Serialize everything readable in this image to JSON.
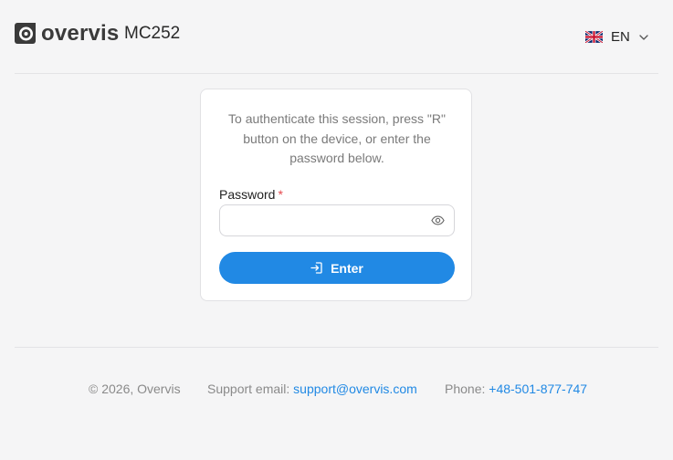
{
  "header": {
    "brand": "overvis",
    "model": "MC252",
    "language": {
      "code": "EN",
      "flag": "uk-flag-icon"
    }
  },
  "login": {
    "message": "To authenticate this session, press \"R\" button on the device, or enter the password below.",
    "password_label": "Password",
    "required_mark": "*",
    "password_value": "",
    "password_placeholder": "",
    "enter_label": "Enter"
  },
  "footer": {
    "copyright": "© 2026, Overvis",
    "support_label": "Support email:",
    "support_email": "support@overvis.com",
    "phone_label": "Phone:",
    "phone": "+48-501-877-747"
  },
  "colors": {
    "accent": "#2189e4",
    "required": "#e5484d",
    "background": "#f5f5f6"
  }
}
